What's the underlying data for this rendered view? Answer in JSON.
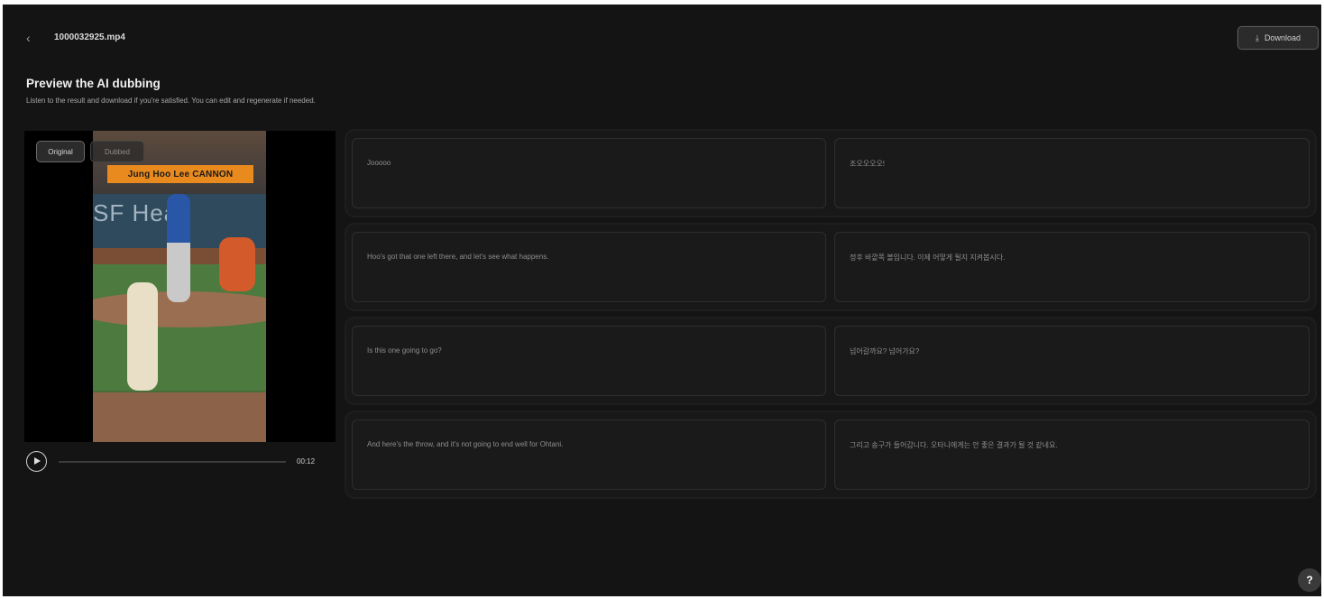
{
  "header": {
    "back_icon": "chevron-left-icon",
    "file_name": "1000032925.mp4",
    "download_label": "Download",
    "download_icon": "download-icon"
  },
  "intro": {
    "title": "Preview the AI dubbing",
    "subtitle": "Listen to the result and download if you're satisfied. You can edit and regenerate if needed."
  },
  "player": {
    "original_label": "Original",
    "dubbed_label": "Dubbed",
    "overlay_text": "Jung Hoo Lee CANNON",
    "billboard_text": "SF Head",
    "time": "00:12",
    "progress": 0
  },
  "segments": [
    {
      "source": "Jooooo",
      "target": "조오오오오!"
    },
    {
      "source": "Hoo's got that one left there, and let's see what happens.",
      "target": "정후 바깥쪽 볼입니다. 이제 어떻게 될지 지켜봅시다."
    },
    {
      "source": "Is this one going to go?",
      "target": "넘어갈까요? 넘어가요?"
    },
    {
      "source": "And here's the throw, and it's not going to end well for Ohtani.",
      "target": "그리고 송구가 들어갑니다. 오타니에게는 안 좋은 결과가 될 것 같네요."
    }
  ],
  "colors": {
    "background": "#141414",
    "panel": "#181818",
    "text": "#e6e6e6"
  },
  "help_icon": "question-mark-icon"
}
